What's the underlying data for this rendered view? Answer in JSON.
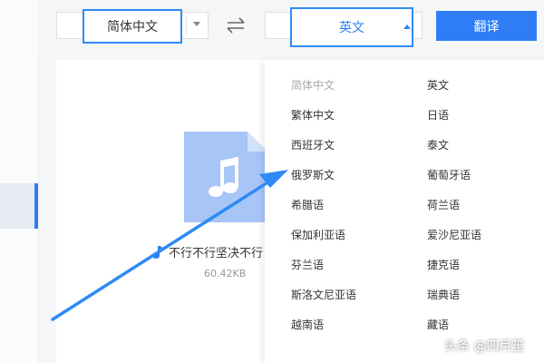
{
  "source": {
    "selected": "简体中文"
  },
  "target": {
    "selected": "英文"
  },
  "toolbar": {
    "translate_label": "翻译"
  },
  "file": {
    "name": "不行不行坚决不行",
    "size": "60.42KB"
  },
  "dropdown": {
    "left_column": [
      "简体中文",
      "繁体中文",
      "西班牙文",
      "俄罗斯文",
      "希腊语",
      "保加利亚语",
      "芬兰语",
      "斯洛文尼亚语",
      "越南语"
    ],
    "right_column": [
      "英文",
      "日语",
      "泰文",
      "葡萄牙语",
      "荷兰语",
      "爱沙尼亚语",
      "捷克语",
      "瑞典语",
      "藏语"
    ],
    "disabled_item": "简体中文"
  },
  "watermark": "头条 @四月笙",
  "colors": {
    "accent": "#2f7df6",
    "highlight_border": "#2f8af5",
    "arrow": "#2f8af5"
  },
  "icons": [
    "chevron-down-icon",
    "swap-icon",
    "chevron-up-icon",
    "audio-file-icon",
    "music-note-icon"
  ]
}
